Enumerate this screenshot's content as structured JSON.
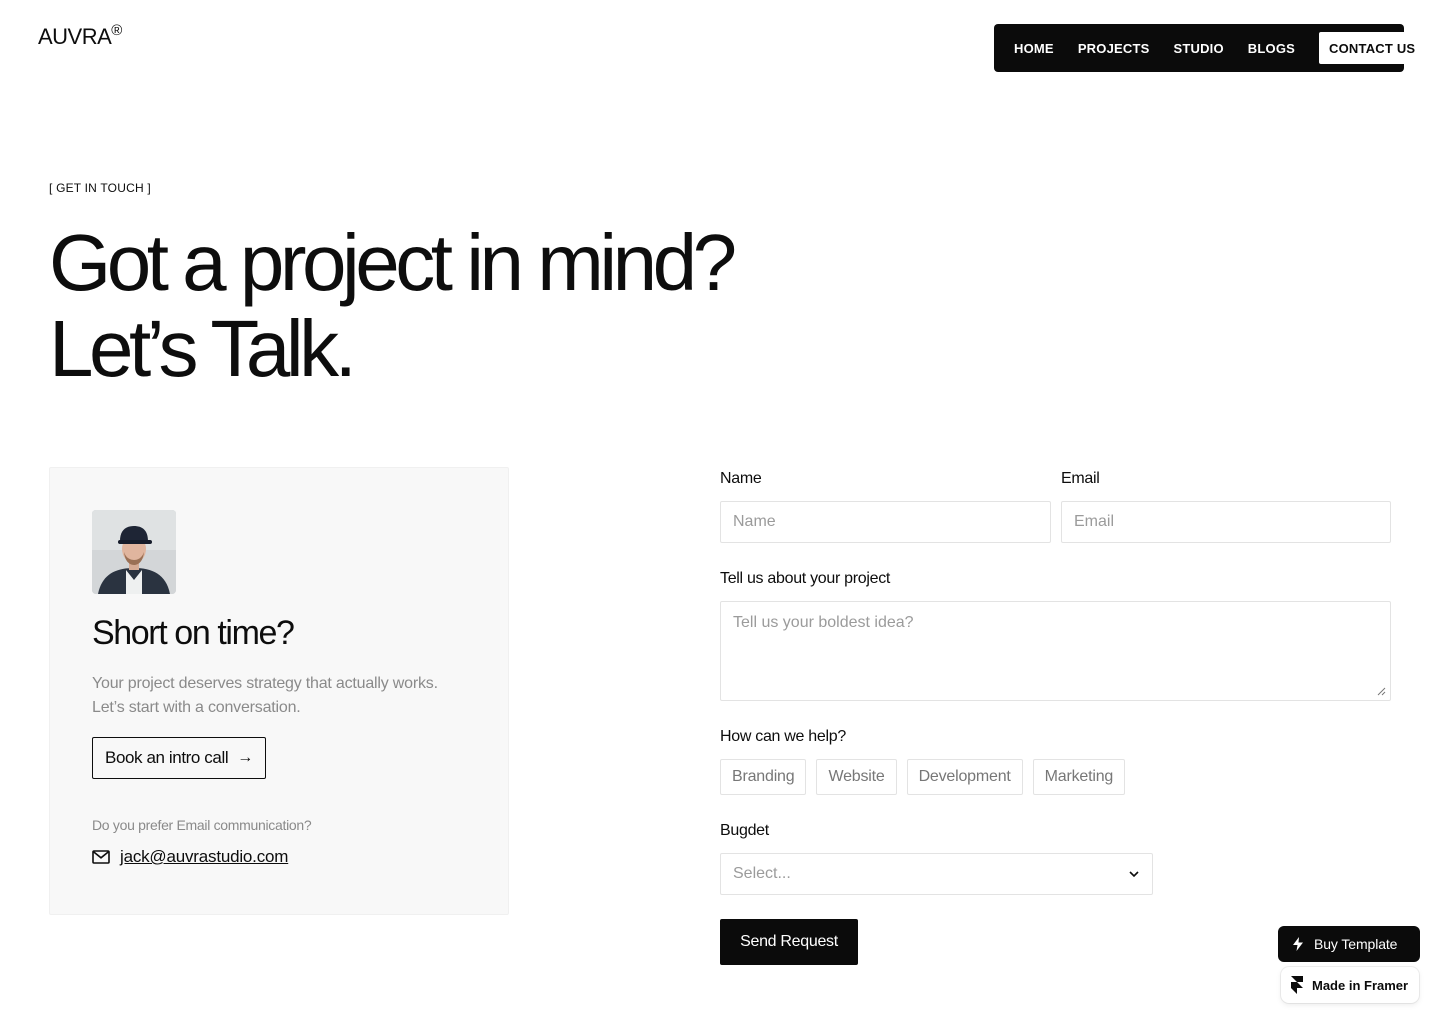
{
  "brand": {
    "name": "AUVRA",
    "mark": "®"
  },
  "nav": {
    "items": [
      {
        "label": "HOME"
      },
      {
        "label": "PROJECTS"
      },
      {
        "label": "STUDIO"
      },
      {
        "label": "BLOGS"
      }
    ],
    "cta": "CONTACT US"
  },
  "hero": {
    "eyebrow": "[ GET IN TOUCH ]",
    "line1": "Got a project in mind?",
    "line2": "Let’s Talk."
  },
  "card": {
    "title": "Short on time?",
    "text_line1": "Your project deserves strategy that actually works.",
    "text_line2": "Let’s start with a conversation.",
    "button": "Book an intro call",
    "button_arrow": "→",
    "pref": "Do you prefer Email communication?",
    "email": "jack@auvrastudio.com"
  },
  "form": {
    "name_label": "Name",
    "name_placeholder": "Name",
    "email_label": "Email",
    "email_placeholder": "Email",
    "project_label": "Tell us about your project",
    "project_placeholder": "Tell us your boldest idea?",
    "help_label": "How can we help?",
    "help_options": [
      "Branding",
      "Website",
      "Development",
      "Marketing"
    ],
    "budget_label": "Bugdet",
    "budget_placeholder": "Select...",
    "submit": "Send Request"
  },
  "badges": {
    "buy": "Buy Template",
    "framer": "Made in Framer"
  }
}
